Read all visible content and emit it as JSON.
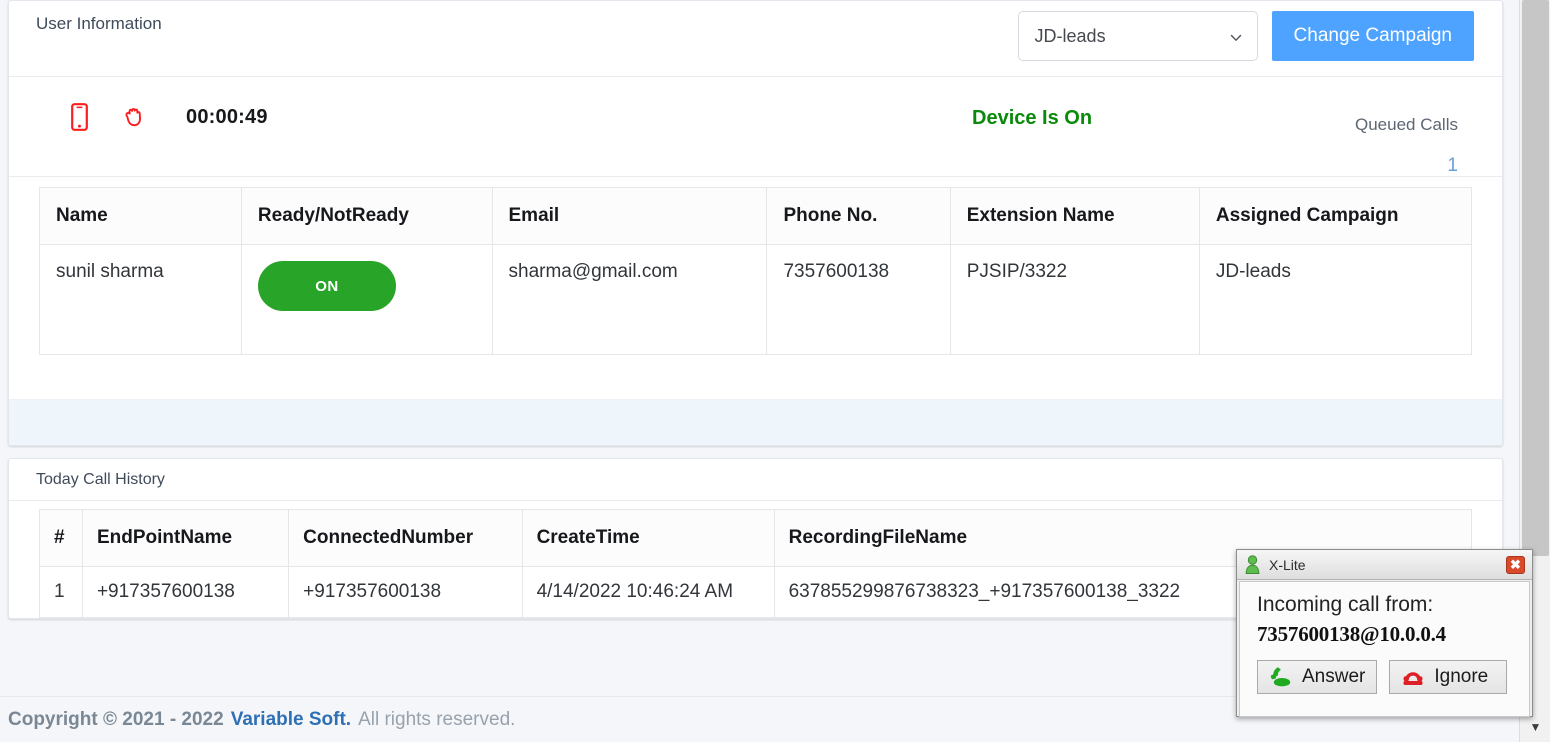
{
  "colors": {
    "accent_blue": "#4da3ff",
    "status_green": "#0a8a0a",
    "toggle_green": "#28a428",
    "icon_red": "#fb1e1e",
    "queued_blue": "#6c9fd8",
    "brand_blue": "#2f6fb5",
    "card_footer_blue": "#eef6fc"
  },
  "user_card": {
    "title": "User Information",
    "campaign_select": {
      "value": "JD-leads",
      "icon": "chevron-down-icon"
    },
    "change_campaign_label": "Change Campaign"
  },
  "status": {
    "mobile_icon": "mobile-phone-icon",
    "hand_icon": "hand-grab-icon",
    "timer": "00:00:49",
    "device_state": "Device Is On",
    "queued_label": "Queued Calls",
    "queued_count": "1"
  },
  "user_table": {
    "headers": [
      "Name",
      "Ready/NotReady",
      "Email",
      "Phone No.",
      "Extension Name",
      "Assigned Campaign"
    ],
    "rows": [
      {
        "name": "sunil sharma",
        "ready_state": "ON",
        "email": "sharma@gmail.com",
        "phone": "7357600138",
        "extension": "PJSIP/3322",
        "campaign": "JD-leads"
      }
    ]
  },
  "history_card": {
    "title": "Today Call History",
    "headers": [
      "#",
      "EndPointName",
      "ConnectedNumber",
      "CreateTime",
      "RecordingFileName"
    ],
    "rows": [
      {
        "index": "1",
        "endpoint": "+917357600138",
        "connected": "+917357600138",
        "createtime": "4/14/2022 10:46:24 AM",
        "recording": "637855299876738323_+917357600138_3322"
      }
    ]
  },
  "footer": {
    "copyright": "Copyright © 2021 - 2022",
    "brand": "Variable Soft.",
    "rights": "All rights reserved."
  },
  "xlite": {
    "app_icon": "user-avatar-icon",
    "title": "X-Lite",
    "close_icon": "close-icon",
    "message_label": "Incoming call from:",
    "caller": "7357600138@10.0.0.4",
    "answer_label": "Answer",
    "answer_icon": "phone-answer-icon",
    "ignore_label": "Ignore",
    "ignore_icon": "phone-hangup-icon"
  },
  "scrollbar": {
    "down_arrow_icon": "scroll-down-arrow-icon"
  }
}
